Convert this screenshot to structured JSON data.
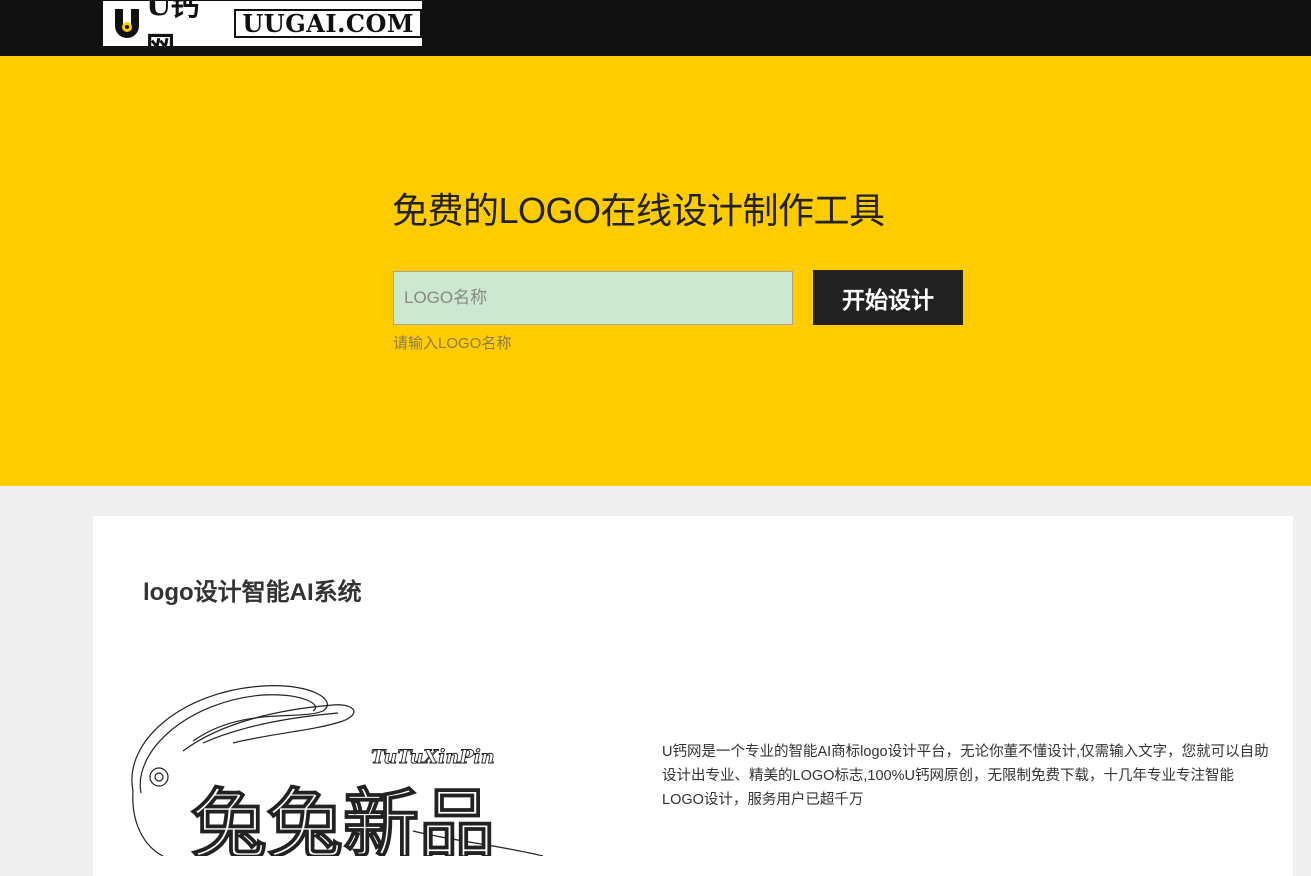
{
  "header": {
    "logo_cn": "U钙网",
    "logo_en": "UUGAI.COM"
  },
  "hero": {
    "title": "免费的LOGO在线设计制作工具",
    "input_placeholder": "LOGO名称",
    "input_value": "",
    "button_label": "开始设计",
    "hint": "请输入LOGO名称"
  },
  "section": {
    "title": "logo设计智能AI系统",
    "description": "U钙网是一个专业的智能AI商标logo设计平台，无论你董不懂设计,仅需输入文字，您就可以自助设计出专业、精美的LOGO标志,100%U钙网原创，无限制免费下载，十几年专业专注智能LOGO设计，服务用户已超千万",
    "example_logo_cn": "兔兔新品",
    "example_logo_en": "TuTuXinPin"
  },
  "colors": {
    "topbar": "#111111",
    "hero": "#ffcc00",
    "button": "#222222",
    "input_bg": "#cce8d0",
    "page_bg": "#efefef"
  }
}
